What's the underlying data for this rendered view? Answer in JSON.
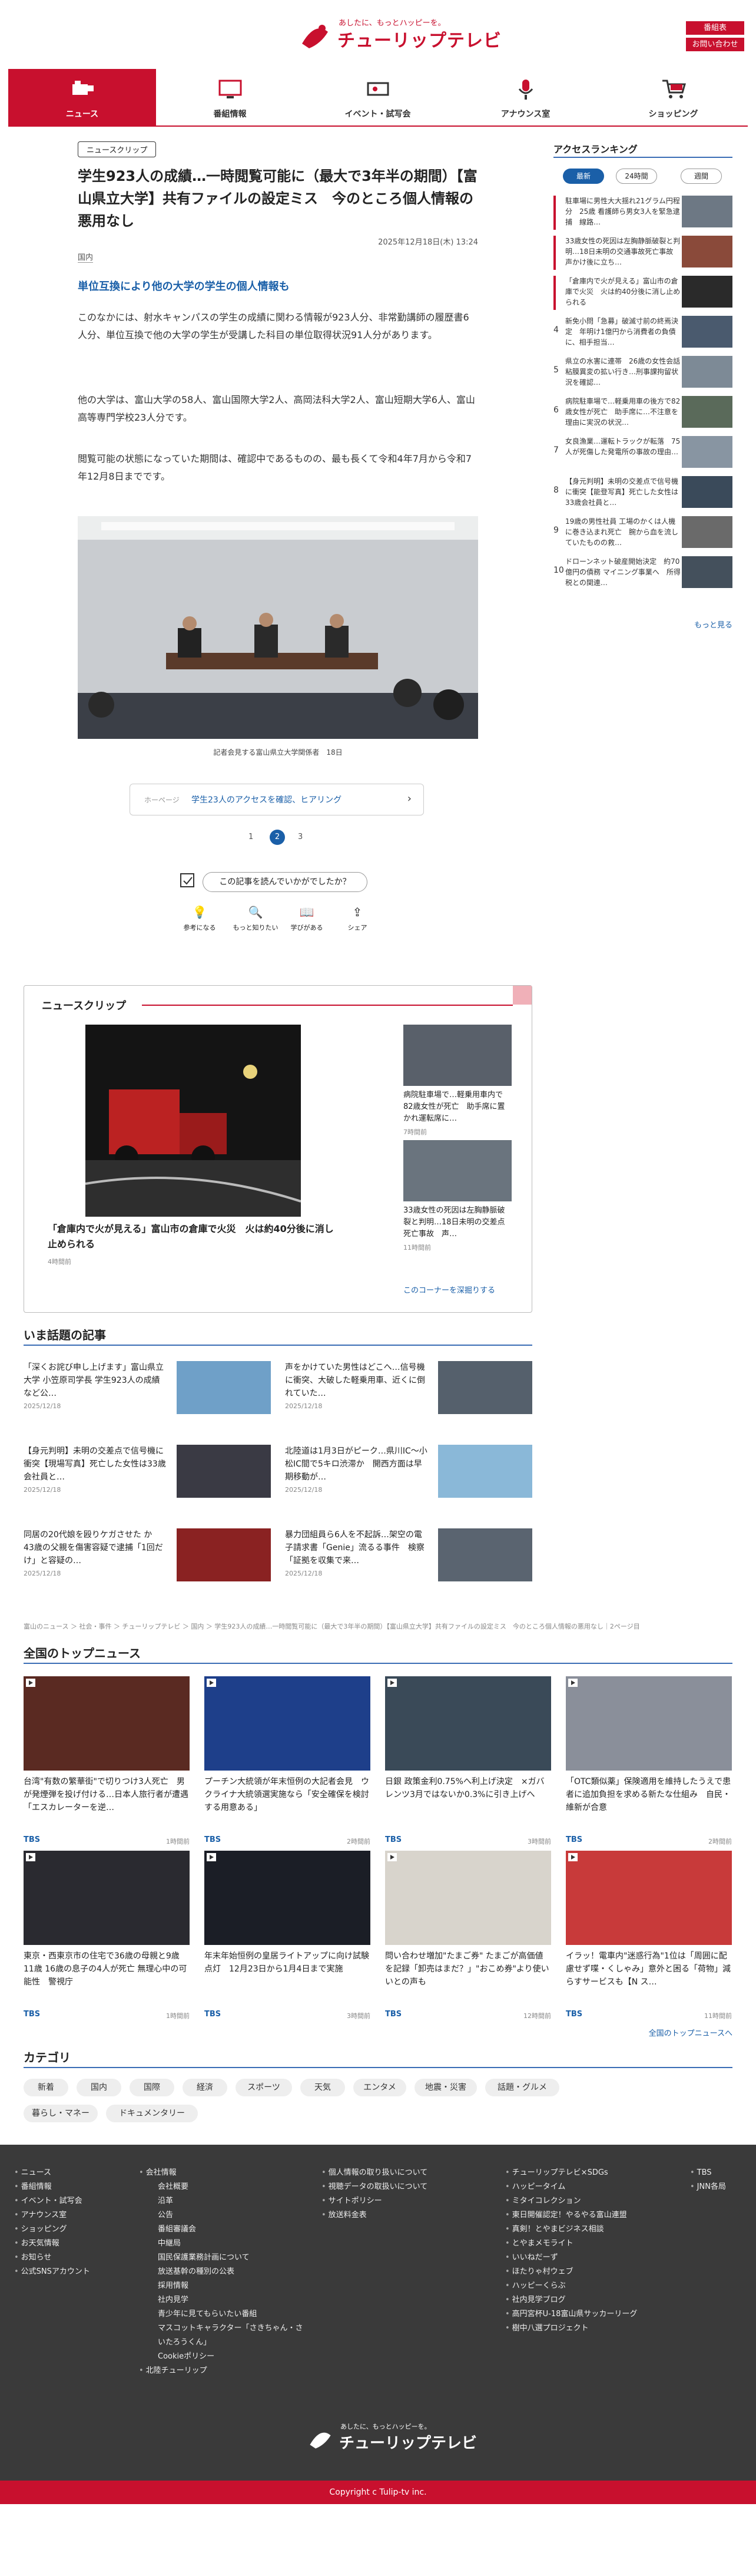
{
  "header": {
    "logo_tagline": "あしたに、もっとハッピーを。",
    "logo_name": "チューリップテレビ",
    "btn_top": "番組表",
    "btn_bottom": "お問い合わせ"
  },
  "gnav": [
    {
      "label": "ニュース",
      "icon": "camera-icon"
    },
    {
      "label": "番組情報",
      "icon": "tv-icon"
    },
    {
      "label": "イベント・試写会",
      "icon": "ticket-icon"
    },
    {
      "label": "アナウンス室",
      "icon": "microphone-icon"
    },
    {
      "label": "ショッピング",
      "icon": "cart-icon"
    }
  ],
  "article": {
    "badge": "ニュースクリップ",
    "title": "学生923人の成績…一時閲覧可能に（最大で3年半の期間）【富山県立大学】共有ファイルの設定ミス　今のところ個人情報の悪用なし",
    "date": "2025年12月18日(木) 13:24",
    "category": "国内",
    "lead": "単位互換により他の大学の学生の個人情報も",
    "paragraphs": [
      "このなかには、射水キャンパスの学生の成績に関わる情報が923人分、非常勤講師の履歴書6人分、単位互換で他の大学の学生が受講した科目の単位取得状況91人分があります。",
      "他の大学は、富山大学の58人、富山国際大学2人、高岡法科大学2人、富山短期大学6人、富山高等専門学校23人分です。",
      "閲覧可能の状態になっていた期間は、確認中であるものの、最も長くて令和4年7月から令和7年12月8日までです。"
    ],
    "caption": "記者会見する富山県立大学関係者　18日",
    "next_label": "ホーページ",
    "next_text": "学生23人のアクセスを確認、ヒアリング",
    "pages": [
      "1",
      "2",
      "3"
    ],
    "current_page": "2",
    "rate_prompt": "この記事を読んでいかがでしたか？",
    "rate_options": [
      "参考になる",
      "もっと知りたい",
      "学びがある",
      "シェア"
    ]
  },
  "ranking": {
    "heading": "アクセスランキング",
    "tabs": [
      "最新",
      "24時間",
      "週間"
    ],
    "items": [
      "駐車場に男性大大揺れ21グラム円程分　25歳 看護師ら男女3人を緊急逮捕　線路…",
      "33歳女性の死因は左胸静脈破裂と判明…18日未明の交通事故死亡事故　声かけ後に立ち…",
      "「倉庫内で火が見える」富山市の倉庫で火災　火は約40分後に消し止められる",
      "新免小問「急募」破滅寸前の終焉決定　年明け1億円から消費者の負債に、相手担当…",
      "県立の水害に連帯　26歳の女性会話粘膜異変の拡い行き…刑事課拘留状況を確認…",
      "病院駐車場で…軽乗用車の後方で82歳女性が死亡　助手席に…不注意を理由に実況の状況…",
      "女良漁業…運転トラックが転落　75人が死傷した発電所の事故の理由…",
      "【身元判明】未明の交差点で信号機に衝突【能登写真】死亡した女性は33歳会社員と…",
      "19歳の男性社員 工場のかくは人機に巻き込まれ死亡　腕から血を流していたものの救…",
      "ドローンネット破産開始決定　約70億円の債務 マイニング事業へ　所得税との関連…"
    ],
    "more": "もっと見る"
  },
  "clip": {
    "heading": "ニュースクリップ",
    "main_title": "「倉庫内で火が見える」富山市の倉庫で火災　火は約40分後に消し止められる",
    "main_date": "4時間前",
    "side": [
      {
        "title": "病院駐車場で…軽乗用車内で82歳女性が死亡　助手席に置かれ運転席に…",
        "date": "7時間前"
      },
      {
        "title": "33歳女性の死因は左胸静脈破裂と判明…18日未明の交差点死亡事故　声…",
        "date": "11時間前"
      }
    ],
    "more": "このコーナーを深掘りする"
  },
  "topics": {
    "heading": "いま話題の記事",
    "items": [
      {
        "title": "「深くお詫び申し上げます」富山県立大学 小笠原司学長 学生923人の成績など公…",
        "date": "2025/12/18"
      },
      {
        "title": "声をかけていた男性はどこへ…信号機に衝突、大破した軽乗用車、近くに倒れていた…",
        "date": "2025/12/18"
      },
      {
        "title": "【身元判明】未明の交差点で信号機に衝突【現場写真】死亡した女性は33歳会社員と…",
        "date": "2025/12/18"
      },
      {
        "title": "北陸道は1月3日がピーク…県川IC〜小松IC間で5キロ渋滞か　開西方面は早期移動が…",
        "date": "2025/12/18"
      },
      {
        "title": "同居の20代娘を殴りケガさせた か　43歳の父親を傷害容疑で逮捕「1回だけ」と容疑の…",
        "date": "2025/12/18"
      },
      {
        "title": "暴力団組員ら6人を不起訴…架空の電子請求書「Genie」流るる事件　検察「証拠を収集で来…",
        "date": "2025/12/18"
      }
    ]
  },
  "breadcrumb": "富山のニュース ＞ 社会・事件 ＞ チューリップテレビ ＞ 国内 ＞ 学生923人の成績…一時閲覧可能に（最大で3年半の期間）【富山県立大学】共有ファイルの設定ミス　今のところ個人情報の悪用なし｜2ページ目",
  "national": {
    "heading": "全国のトップニュース",
    "items": [
      {
        "title": "台湾\"有数の繁華街\"で切りつけ3人死亡　男が発煙弾を投げ付ける…日本人旅行者が遭遇「エスカレーターを逆…",
        "source": "TBS",
        "date": "1時間前"
      },
      {
        "title": "プーチン大統領が年末恒例の大記者会見　ウクライナ大統領選実施なら「安全確保を検討する用意ある」",
        "source": "TBS",
        "date": "2時間前"
      },
      {
        "title": "日銀 政策金利0.75%へ利上げ決定　×ガバレンツ3月ではないか0.3%に引き上げへ",
        "source": "TBS",
        "date": "3時間前"
      },
      {
        "title": "「OTC類似薬」保険適用を維持したうえで患者に追加負担を求める新たな仕組み　自民・維新が合意",
        "source": "TBS",
        "date": "2時間前"
      },
      {
        "title": "東京・西東京市の住宅で36歳の母親と9歳 11歳 16歳の息子の4人が死亡 無理心中の可能性　警視庁",
        "source": "TBS",
        "date": "1時間前"
      },
      {
        "title": "年末年始恒例の皇居ライトアップに向け試験点灯　12月23日から1月4日まで実施",
        "source": "TBS",
        "date": "3時間前"
      },
      {
        "title": "問い合わせ増加\"たまご券\" たまごが高価値を記録「卸売はまだ？」\"おこめ券\"より使いいとの声も",
        "source": "TBS",
        "date": "12時間前"
      },
      {
        "title": "イラッ！電車内\"迷惑行為\"1位は「周囲に配慮せず喋・くしゃみ」意外と困る「荷物」減らすサービスも【N ス…",
        "source": "TBS",
        "date": "11時間前"
      }
    ],
    "more": "全国のトップニュースへ"
  },
  "categories": {
    "heading": "カテゴリ",
    "items": [
      "新着",
      "国内",
      "国際",
      "経済",
      "スポーツ",
      "天気",
      "エンタメ",
      "地震・災害",
      "話題・グルメ",
      "暮らし・マネー",
      "ドキュメンタリー"
    ]
  },
  "footer": {
    "col1": [
      "ニュース",
      "番組情報",
      "イベント・試写会",
      "アナウンス室",
      "ショッピング",
      "お天気情報",
      "お知らせ",
      "公式SNSアカウント"
    ],
    "col2": [
      "会社情報",
      "会社概要",
      "沿革",
      "公告",
      "番組審議会",
      "中継局",
      "国民保護業務計画について",
      "放送基幹の種別の公表",
      "採用情報",
      "社内見学",
      "青少年に見てもらいたい番組",
      "マスコットキャラクター「さきちゃん・さいたろうくん」",
      "Cookieポリシー",
      "北陸チューリップ"
    ],
    "col3": [
      "個人情報の取り扱いについて",
      "視聴データの取扱いについて",
      "サイトポリシー",
      "放送料金表"
    ],
    "col4": [
      "チューリップテレビ×SDGs",
      "ハッピータイム",
      "ミタイコレクション",
      "東日開催認定！やるやる富山連盟",
      "真剣！とやまビジネス相談",
      "とやまメモライト",
      "いいねだーず",
      "ほたりゃ村ウェブ",
      "ハッピーくらぶ",
      "社内見学ブログ",
      "高円宮杯U-18富山県サッカーリーグ",
      "樹中八選プロジェクト"
    ],
    "col5": [
      "TBS",
      "JNN各局"
    ],
    "logo_tagline": "あしたに、もっとハッピーを。",
    "logo_name": "チューリップテレビ",
    "copyright": "Copyright c Tulip-tv inc."
  },
  "colors": {
    "brand": "#c8102e",
    "link": "#1a5fa8",
    "footer": "#3a3a3a"
  }
}
